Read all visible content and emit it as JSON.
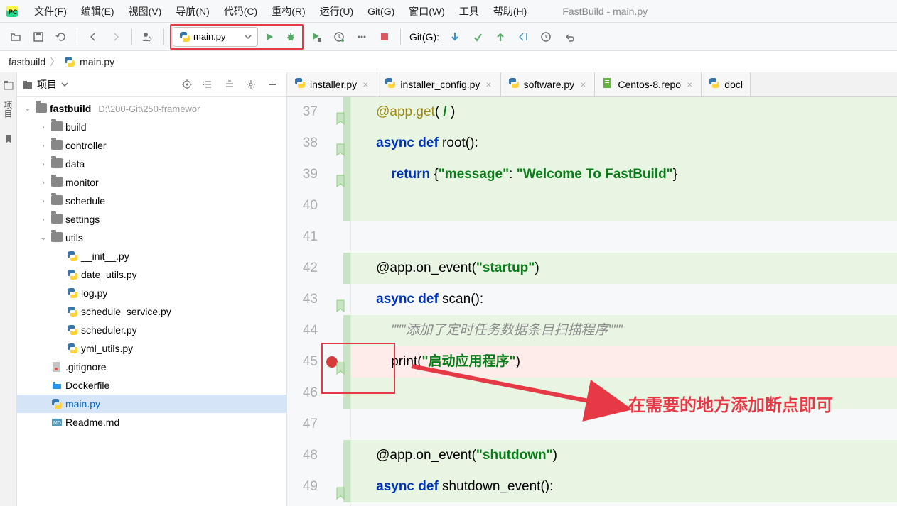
{
  "window": {
    "title": "FastBuild - main.py"
  },
  "menu": [
    {
      "label": "文件(F)"
    },
    {
      "label": "编辑(E)"
    },
    {
      "label": "视图(V)"
    },
    {
      "label": "导航(N)"
    },
    {
      "label": "代码(C)"
    },
    {
      "label": "重构(R)"
    },
    {
      "label": "运行(U)"
    },
    {
      "label": "Git(G)"
    },
    {
      "label": "窗口(W)"
    },
    {
      "label": "工具"
    },
    {
      "label": "帮助(H)"
    }
  ],
  "runConfig": {
    "label": "main.py"
  },
  "gitLabel": "Git(G):",
  "breadcrumb": [
    {
      "label": "fastbuild"
    },
    {
      "label": "main.py",
      "icon": "py"
    }
  ],
  "sideTabs": {
    "project": "项目"
  },
  "projectPanel": {
    "title": "项目"
  },
  "tree": {
    "root": {
      "label": "fastbuild",
      "path": "D:\\200-Git\\250-framewor"
    },
    "folders": [
      {
        "label": "build"
      },
      {
        "label": "controller"
      },
      {
        "label": "data"
      },
      {
        "label": "monitor"
      },
      {
        "label": "schedule"
      },
      {
        "label": "settings"
      },
      {
        "label": "utils",
        "expanded": true
      }
    ],
    "utilsFiles": [
      {
        "label": "__init__.py"
      },
      {
        "label": "date_utils.py"
      },
      {
        "label": "log.py"
      },
      {
        "label": "schedule_service.py"
      },
      {
        "label": "scheduler.py"
      },
      {
        "label": "yml_utils.py"
      }
    ],
    "rootFiles": [
      {
        "label": ".gitignore",
        "type": "git"
      },
      {
        "label": "Dockerfile",
        "type": "docker"
      },
      {
        "label": "main.py",
        "type": "py",
        "selected": true,
        "blue": true
      },
      {
        "label": "Readme.md",
        "type": "md"
      }
    ]
  },
  "editorTabs": [
    {
      "label": "installer.py",
      "icon": "py"
    },
    {
      "label": "installer_config.py",
      "icon": "py"
    },
    {
      "label": "software.py",
      "icon": "py"
    },
    {
      "label": "Centos-8.repo",
      "icon": "txt"
    },
    {
      "label": "docl",
      "icon": "py",
      "partial": true
    }
  ],
  "code": {
    "lines": [
      {
        "n": 37,
        "bg": "green",
        "fold": true,
        "segs": [
          {
            "t": "    ",
            "c": ""
          },
          {
            "t": "@app.get",
            "c": "dec"
          },
          {
            "t": "(",
            "c": ""
          },
          {
            "t": " / ",
            "c": "str"
          },
          {
            "t": ")",
            "c": ""
          }
        ]
      },
      {
        "n": 38,
        "bg": "green",
        "fold": true,
        "segs": [
          {
            "t": "    ",
            "c": ""
          },
          {
            "t": "async def",
            "c": "kw"
          },
          {
            "t": " root():",
            "c": ""
          }
        ]
      },
      {
        "n": 39,
        "bg": "green",
        "fold": true,
        "segs": [
          {
            "t": "        ",
            "c": ""
          },
          {
            "t": "return",
            "c": "kw"
          },
          {
            "t": " {",
            "c": ""
          },
          {
            "t": "\"message\"",
            "c": "str"
          },
          {
            "t": ": ",
            "c": ""
          },
          {
            "t": "\"Welcome To FastBuild\"",
            "c": "str"
          },
          {
            "t": "}",
            "c": ""
          }
        ]
      },
      {
        "n": 40,
        "bg": "green",
        "segs": []
      },
      {
        "n": 41,
        "bg": "",
        "segs": []
      },
      {
        "n": 42,
        "bg": "green",
        "segs": [
          {
            "t": "    @app.on_event(",
            "c": ""
          },
          {
            "t": "\"startup\"",
            "c": "str"
          },
          {
            "t": ")",
            "c": ""
          }
        ]
      },
      {
        "n": 43,
        "bg": "",
        "fold": true,
        "segs": [
          {
            "t": "    ",
            "c": ""
          },
          {
            "t": "async def",
            "c": "kw"
          },
          {
            "t": " scan():",
            "c": ""
          }
        ]
      },
      {
        "n": 44,
        "bg": "green",
        "segs": [
          {
            "t": "        ",
            "c": ""
          },
          {
            "t": "\"\"\"添加了定时任务数据条目扫描程序\"\"\"",
            "c": "doc"
          }
        ]
      },
      {
        "n": 45,
        "bg": "pink",
        "fold": true,
        "bp": true,
        "segs": [
          {
            "t": "        print(",
            "c": ""
          },
          {
            "t": "\"启动应用程序\"",
            "c": "str"
          },
          {
            "t": ")",
            "c": ""
          }
        ]
      },
      {
        "n": 46,
        "bg": "green",
        "segs": []
      },
      {
        "n": 47,
        "bg": "",
        "segs": []
      },
      {
        "n": 48,
        "bg": "green",
        "segs": [
          {
            "t": "    @app.on_event(",
            "c": ""
          },
          {
            "t": "\"shutdown\"",
            "c": "str"
          },
          {
            "t": ")",
            "c": ""
          }
        ]
      },
      {
        "n": 49,
        "bg": "green",
        "fold": true,
        "segs": [
          {
            "t": "    ",
            "c": ""
          },
          {
            "t": "async def",
            "c": "kw"
          },
          {
            "t": " shutdown_event():",
            "c": ""
          }
        ]
      }
    ]
  },
  "annotation": {
    "text": "在需要的地方添加断点即可"
  }
}
